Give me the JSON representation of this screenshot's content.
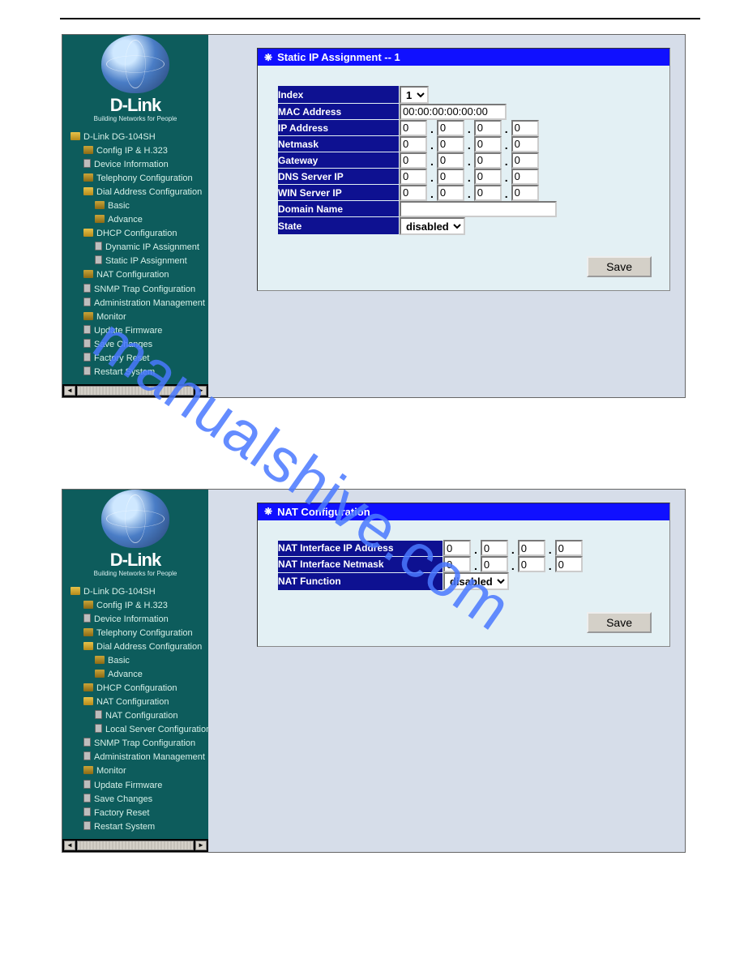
{
  "watermark": "manualshive.com",
  "brand": {
    "name": "D-Link",
    "tagline": "Building Networks for People"
  },
  "shot1": {
    "sidebar": {
      "root": "D-Link DG-104SH",
      "items": [
        {
          "label": "Config IP & H.323",
          "level": 2,
          "icon": "folder-c"
        },
        {
          "label": "Device Information",
          "level": 2,
          "icon": "page"
        },
        {
          "label": "Telephony Configuration",
          "level": 2,
          "icon": "folder-c"
        },
        {
          "label": "Dial Address Configuration",
          "level": 2,
          "icon": "folder-o"
        },
        {
          "label": "Basic",
          "level": 3,
          "icon": "folder-c"
        },
        {
          "label": "Advance",
          "level": 3,
          "icon": "folder-c"
        },
        {
          "label": "DHCP Configuration",
          "level": 2,
          "icon": "folder-o"
        },
        {
          "label": "Dynamic IP Assignment",
          "level": 3,
          "icon": "page"
        },
        {
          "label": "Static IP Assignment",
          "level": 3,
          "icon": "page"
        },
        {
          "label": "NAT Configuration",
          "level": 2,
          "icon": "folder-c"
        },
        {
          "label": "SNMP Trap Configuration",
          "level": 2,
          "icon": "page"
        },
        {
          "label": "Administration Management",
          "level": 2,
          "icon": "page"
        },
        {
          "label": "Monitor",
          "level": 2,
          "icon": "folder-c"
        },
        {
          "label": "Update Firmware",
          "level": 2,
          "icon": "page"
        },
        {
          "label": "Save Changes",
          "level": 2,
          "icon": "page"
        },
        {
          "label": "Factory Reset",
          "level": 2,
          "icon": "page"
        },
        {
          "label": "Restart System",
          "level": 2,
          "icon": "page"
        }
      ]
    },
    "panel": {
      "title": "Static IP Assignment -- 1",
      "fields": {
        "index": {
          "label": "Index",
          "value": "1"
        },
        "mac": {
          "label": "MAC Address",
          "value": "00:00:00:00:00:00"
        },
        "ip": {
          "label": "IP Address",
          "oct": [
            "0",
            "0",
            "0",
            "0"
          ]
        },
        "netmask": {
          "label": "Netmask",
          "oct": [
            "0",
            "0",
            "0",
            "0"
          ]
        },
        "gateway": {
          "label": "Gateway",
          "oct": [
            "0",
            "0",
            "0",
            "0"
          ]
        },
        "dns": {
          "label": "DNS Server IP",
          "oct": [
            "0",
            "0",
            "0",
            "0"
          ]
        },
        "win": {
          "label": "WIN Server IP",
          "oct": [
            "0",
            "0",
            "0",
            "0"
          ]
        },
        "domain": {
          "label": "Domain Name",
          "value": ""
        },
        "state": {
          "label": "State",
          "value": "disabled"
        }
      },
      "save": "Save"
    }
  },
  "shot2": {
    "sidebar": {
      "root": "D-Link DG-104SH",
      "items": [
        {
          "label": "Config IP & H.323",
          "level": 2,
          "icon": "folder-c"
        },
        {
          "label": "Device Information",
          "level": 2,
          "icon": "page"
        },
        {
          "label": "Telephony Configuration",
          "level": 2,
          "icon": "folder-c"
        },
        {
          "label": "Dial Address Configuration",
          "level": 2,
          "icon": "folder-o"
        },
        {
          "label": "Basic",
          "level": 3,
          "icon": "folder-c"
        },
        {
          "label": "Advance",
          "level": 3,
          "icon": "folder-c"
        },
        {
          "label": "DHCP Configuration",
          "level": 2,
          "icon": "folder-c"
        },
        {
          "label": "NAT Configuration",
          "level": 2,
          "icon": "folder-o"
        },
        {
          "label": "NAT Configuration",
          "level": 3,
          "icon": "page"
        },
        {
          "label": "Local Server Configuration",
          "level": 3,
          "icon": "page"
        },
        {
          "label": "SNMP Trap Configuration",
          "level": 2,
          "icon": "page"
        },
        {
          "label": "Administration Management",
          "level": 2,
          "icon": "page"
        },
        {
          "label": "Monitor",
          "level": 2,
          "icon": "folder-c"
        },
        {
          "label": "Update Firmware",
          "level": 2,
          "icon": "page"
        },
        {
          "label": "Save Changes",
          "level": 2,
          "icon": "page"
        },
        {
          "label": "Factory Reset",
          "level": 2,
          "icon": "page"
        },
        {
          "label": "Restart System",
          "level": 2,
          "icon": "page"
        }
      ]
    },
    "panel": {
      "title": "NAT Configuration",
      "fields": {
        "nat_ip": {
          "label": "NAT Interface IP Address",
          "oct": [
            "0",
            "0",
            "0",
            "0"
          ]
        },
        "nat_nm": {
          "label": "NAT Interface Netmask",
          "oct": [
            "0",
            "0",
            "0",
            "0"
          ]
        },
        "nat_fn": {
          "label": "NAT Function",
          "value": "disabled"
        }
      },
      "save": "Save"
    }
  }
}
